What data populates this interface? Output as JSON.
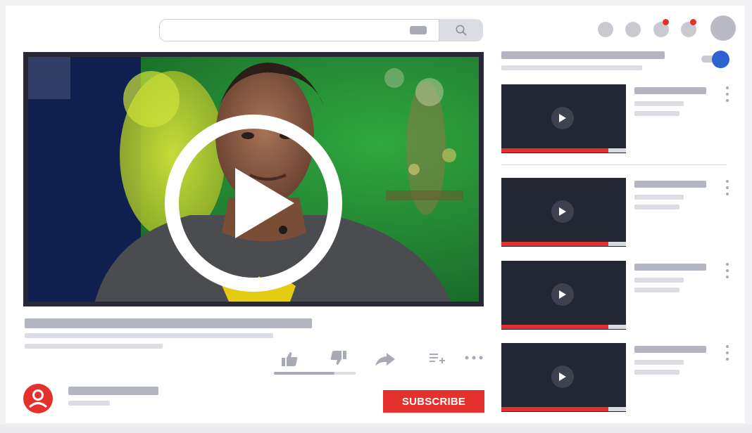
{
  "header": {
    "search": {
      "placeholder": ""
    }
  },
  "player": {
    "state": "paused"
  },
  "actions": {
    "icons": [
      "thumbs-up-icon",
      "thumbs-down-icon",
      "share-icon",
      "add-to-playlist-icon",
      "more-horizontal-icon"
    ]
  },
  "channel": {
    "subscribe_label": "SUBSCRIBE"
  },
  "sidebar": {
    "autoplay_on": true,
    "recommendations_count": 4
  },
  "colors": {
    "accent_red": "#e5312d",
    "toggle_blue": "#2e62d3",
    "placeholder_dark": "#b3b5c0",
    "placeholder_light": "#dcdde2",
    "thumb_bg": "#232734"
  }
}
